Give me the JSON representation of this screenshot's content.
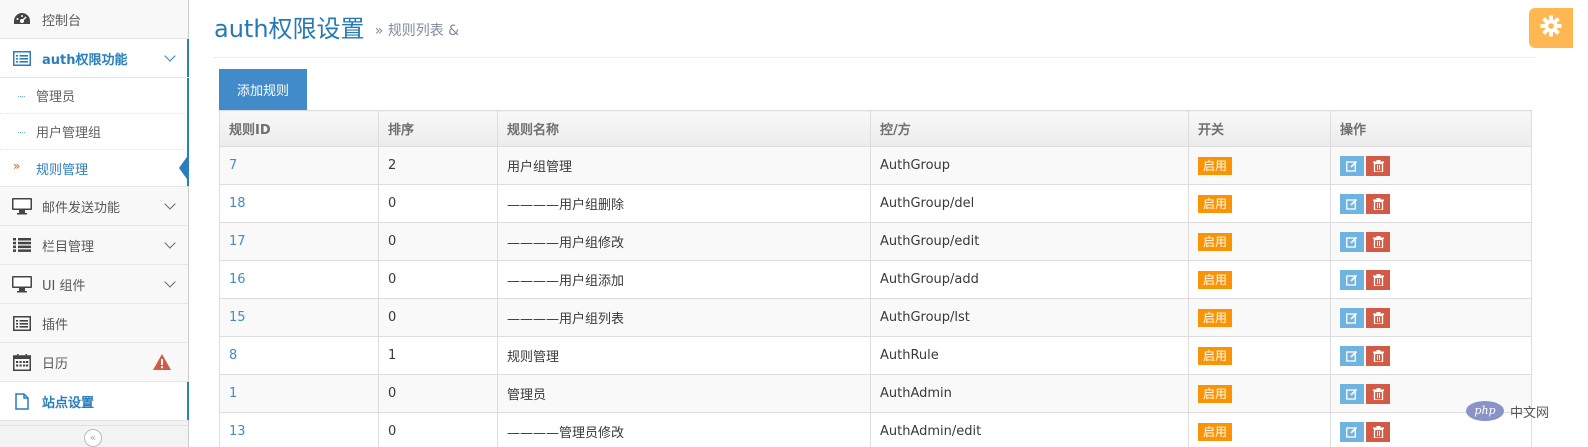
{
  "sidebar": {
    "items": [
      {
        "label": "控制台",
        "icon": "dashboard-icon"
      },
      {
        "label": "auth权限功能",
        "icon": "list-alt-icon"
      },
      {
        "label": "邮件发送功能",
        "icon": "desktop-icon"
      },
      {
        "label": "栏目管理",
        "icon": "list-icon"
      },
      {
        "label": "UI 组件",
        "icon": "desktop-icon"
      },
      {
        "label": "插件",
        "icon": "list-alt-icon"
      },
      {
        "label": "日历",
        "icon": "calendar-icon"
      },
      {
        "label": "站点设置",
        "icon": "file-icon"
      }
    ],
    "submenu": [
      {
        "label": "管理员"
      },
      {
        "label": "用户管理组"
      },
      {
        "label": "规则管理"
      }
    ],
    "collapse_glyph": "«"
  },
  "header": {
    "title": "auth权限设置",
    "subtitle": "» 规则列表 &"
  },
  "toolbar": {
    "add_label": "添加规则"
  },
  "table": {
    "columns": [
      "规则ID",
      "排序",
      "规则名称",
      "控/方",
      "开关",
      "操作"
    ],
    "rows": [
      {
        "id": "7",
        "sort": "2",
        "name": "用户组管理",
        "path": "AuthGroup",
        "status": "启用"
      },
      {
        "id": "18",
        "sort": "0",
        "name": "————用户组删除",
        "path": "AuthGroup/del",
        "status": "启用"
      },
      {
        "id": "17",
        "sort": "0",
        "name": "————用户组修改",
        "path": "AuthGroup/edit",
        "status": "启用"
      },
      {
        "id": "16",
        "sort": "0",
        "name": "————用户组添加",
        "path": "AuthGroup/add",
        "status": "启用"
      },
      {
        "id": "15",
        "sort": "0",
        "name": "————用户组列表",
        "path": "AuthGroup/lst",
        "status": "启用"
      },
      {
        "id": "8",
        "sort": "1",
        "name": "规则管理",
        "path": "AuthRule",
        "status": "启用"
      },
      {
        "id": "1",
        "sort": "0",
        "name": "管理员",
        "path": "AuthAdmin",
        "status": "启用"
      },
      {
        "id": "13",
        "sort": "0",
        "name": "————管理员修改",
        "path": "AuthAdmin/edit",
        "status": "启用"
      }
    ]
  },
  "watermark": {
    "logo": "php",
    "text": "中文网"
  },
  "colors": {
    "accent": "#2b7dbc",
    "primary_button": "#428bca",
    "status_badge": "#f89406",
    "edit_button": "#6fb3e0",
    "delete_button": "#d15b47",
    "settings_button": "#ffb752",
    "alert_icon": "#d15b47"
  }
}
